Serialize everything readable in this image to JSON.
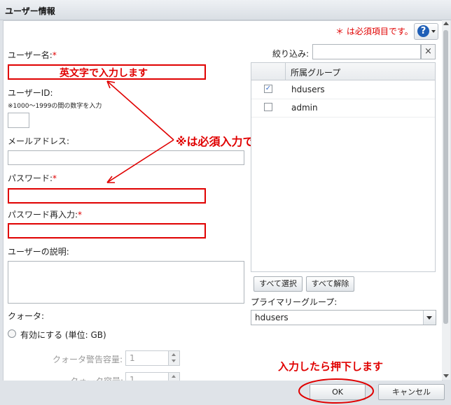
{
  "window": {
    "title": "ユーザー情報"
  },
  "required_note": "＊ は必須項目です。",
  "help": {
    "icon_label": "?"
  },
  "form": {
    "username": {
      "label": "ユーザー名:",
      "star": "*",
      "value": ""
    },
    "userid": {
      "label": "ユーザーID:",
      "hint": "※1000〜1999の間の数字を入力",
      "value": ""
    },
    "email": {
      "label": "メールアドレス:",
      "value": ""
    },
    "password": {
      "label": "パスワード:",
      "star": "*",
      "value": ""
    },
    "password_confirm": {
      "label": "パスワード再入力:",
      "star": "*",
      "value": ""
    },
    "description": {
      "label": "ユーザーの説明:",
      "value": ""
    },
    "quota": {
      "label": "クォータ:",
      "enable_label": "有効にする (単位: GB)",
      "warning_label": "クォータ警告容量:",
      "warning_value": "1",
      "capacity_label": "クォータ容量:",
      "capacity_value": "1"
    }
  },
  "groups": {
    "filter_label": "絞り込み:",
    "filter_value": "",
    "filter_clear": "×",
    "column_header": "所属グループ",
    "rows": [
      {
        "name": "hdusers",
        "checked": true,
        "mark": "✓"
      },
      {
        "name": "admin",
        "checked": false,
        "mark": ""
      }
    ],
    "select_all": "すべて選択",
    "deselect_all": "すべて解除",
    "primary_label": "プライマリーグループ:",
    "primary_value": "hdusers"
  },
  "annotations": {
    "username_hint": "英文字で入力します",
    "required_hint": "※は必須入力ですので入力します",
    "ok_hint": "入力したら押下します"
  },
  "footer": {
    "ok": "OK",
    "cancel": "キャンセル"
  },
  "colors": {
    "annotation_red": "#e00000",
    "help_blue": "#1f5fb7"
  }
}
